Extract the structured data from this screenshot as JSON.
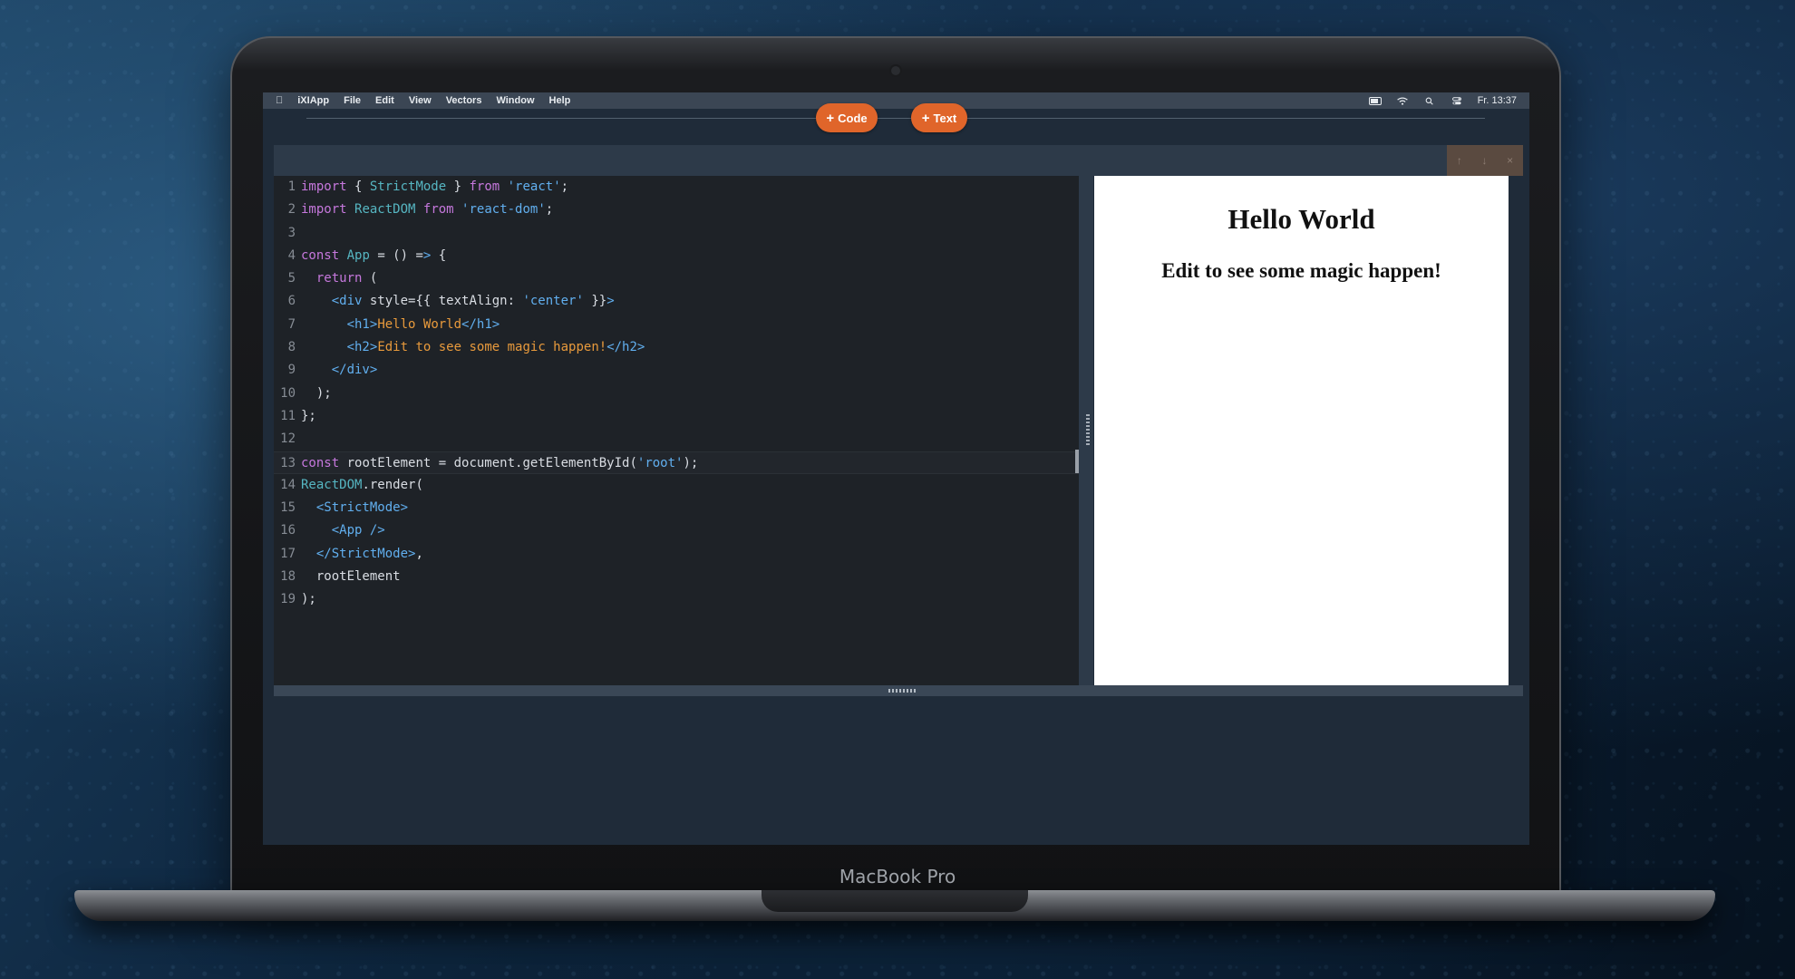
{
  "menubar": {
    "app_name": "iXIApp",
    "items": [
      "File",
      "Edit",
      "View",
      "Vectors",
      "Window",
      "Help"
    ],
    "clock": "Fr. 13:37"
  },
  "toolbar": {
    "add_code_label": "Code",
    "add_text_label": "Text"
  },
  "panel_controls": {
    "up": "↑",
    "down": "↓",
    "close": "×"
  },
  "editor": {
    "active_line": 13,
    "lines": [
      "import { StrictMode } from 'react';",
      "import ReactDOM from 'react-dom';",
      "",
      "const App = () => {",
      "  return (",
      "    <div style={{ textAlign: 'center' }}>",
      "      <h1>Hello World</h1>",
      "      <h2>Edit to see some magic happen!</h2>",
      "    </div>",
      "  );",
      "};",
      "",
      "const rootElement = document.getElementById('root');",
      "ReactDOM.render(",
      "  <StrictMode>",
      "    <App />",
      "  </StrictMode>,",
      "  rootElement",
      ");"
    ]
  },
  "preview": {
    "heading": "Hello World",
    "subheading": "Edit to see some magic happen!"
  },
  "device": {
    "label": "MacBook Pro"
  },
  "colors": {
    "accent": "#e0652a",
    "screen_bg": "#1f2b39",
    "editor_bg": "#1e2227"
  }
}
